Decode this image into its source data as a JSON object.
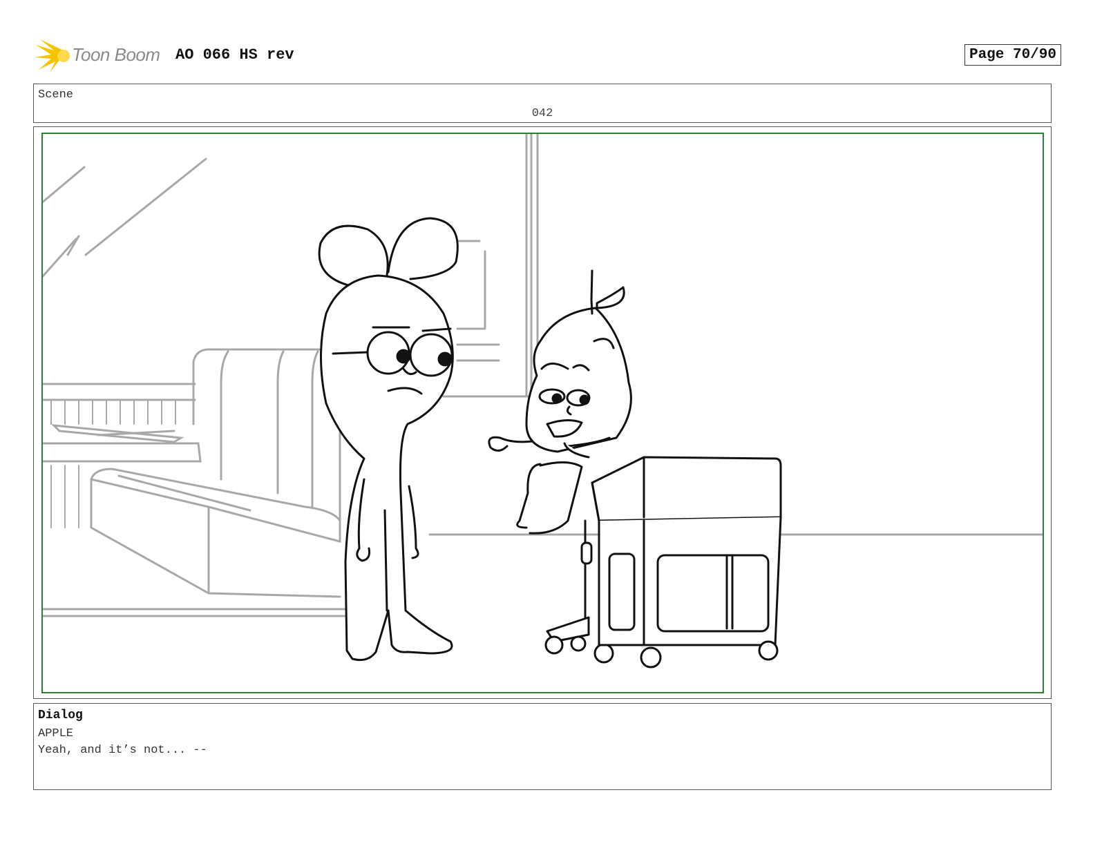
{
  "header": {
    "logo_text": "Toon Boom",
    "title": "AO 066 HS rev",
    "page": "Page 70/90"
  },
  "scene": {
    "label": "Scene",
    "number": "042"
  },
  "dialog": {
    "heading": "Dialog",
    "character": "APPLE",
    "line": "Yeah, and it’s not... --"
  },
  "colors": {
    "frame_border": "#2e7d32",
    "logo_burst": "#f5c400"
  }
}
